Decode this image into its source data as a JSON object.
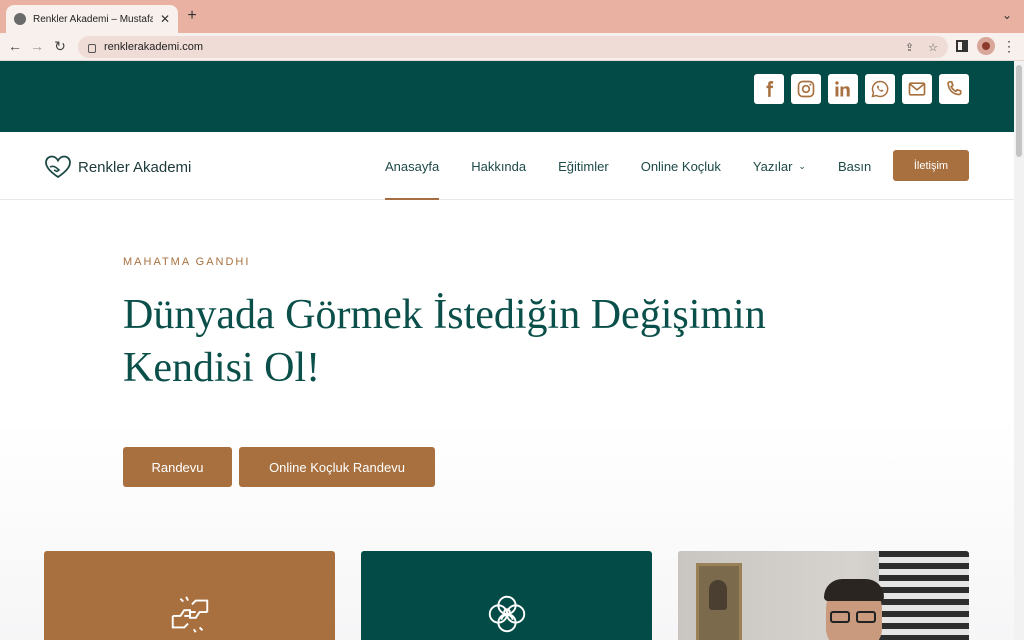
{
  "browser": {
    "tab_title": "Renkler Akademi – Mustafa Şa",
    "url": "renklerakademi.com"
  },
  "site": {
    "brand": "Renkler Akademi",
    "nav": [
      {
        "label": "Anasayfa"
      },
      {
        "label": "Hakkında"
      },
      {
        "label": "Eğitimler"
      },
      {
        "label": "Online Koçluk"
      },
      {
        "label": "Yazılar"
      },
      {
        "label": "Basın"
      }
    ],
    "cta": "İletişim",
    "social_icons": [
      "facebook-icon",
      "instagram-icon",
      "linkedin-icon",
      "whatsapp-icon",
      "mail-icon",
      "phone-icon"
    ]
  },
  "hero": {
    "eyebrow": "MAHATMA GANDHI",
    "headline_line1": "Dünyada Görmek İstediğin Değişimin",
    "headline_line2": "Kendisi Ol!",
    "button_primary": "Randevu",
    "button_secondary": "Online Koçluk Randevu"
  },
  "colors": {
    "teal": "#024b47",
    "accent": "#a8703f",
    "tabbar": "#e8b1a2"
  }
}
